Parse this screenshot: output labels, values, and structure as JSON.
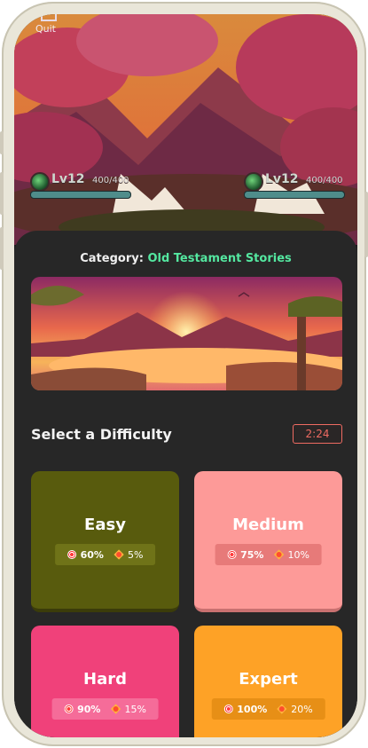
{
  "header": {
    "quit_label": "Quit",
    "player_left": {
      "level": "Lv12",
      "hp": "400/400",
      "hp_fraction": 1.0
    },
    "player_right": {
      "level": "Lv12",
      "hp": "400/400",
      "hp_fraction": 1.0
    }
  },
  "category": {
    "prefix": "Category:",
    "value": "Old Testament Stories"
  },
  "difficulty": {
    "title": "Select a Difficulty",
    "timer": "2:24",
    "options": [
      {
        "name": "Easy",
        "accuracy": "60%",
        "bonus": "5%"
      },
      {
        "name": "Medium",
        "accuracy": "75%",
        "bonus": "10%"
      },
      {
        "name": "Hard",
        "accuracy": "90%",
        "bonus": "15%"
      },
      {
        "name": "Expert",
        "accuracy": "100%",
        "bonus": "20%"
      }
    ]
  },
  "colors": {
    "easy": "#585b0d",
    "medium": "#fd9a98",
    "hard": "#f0417a",
    "expert": "#fea226",
    "category_accent": "#54e7a0",
    "timer_accent": "#ef6b62"
  },
  "icons": {
    "accuracy": "target-icon",
    "bonus": "burst-icon",
    "quit": "quit-door-icon"
  }
}
